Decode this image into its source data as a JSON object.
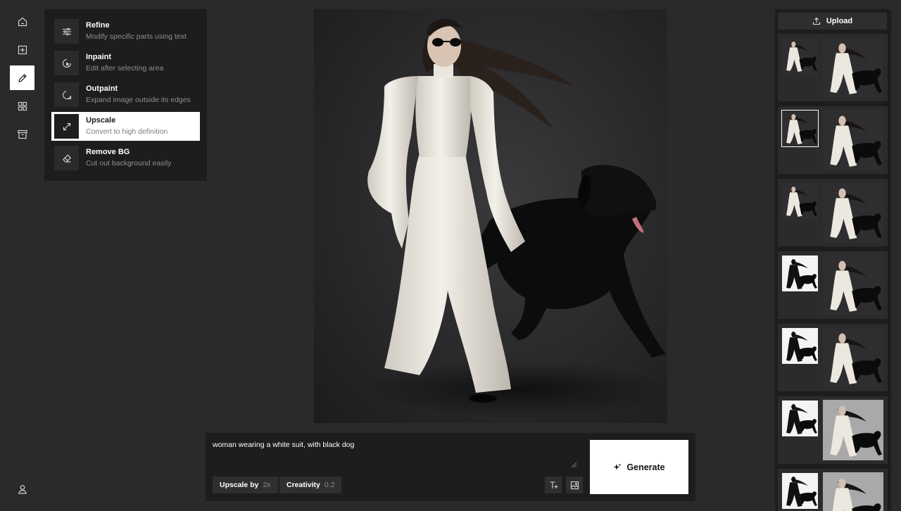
{
  "rail": {
    "items": [
      {
        "name": "home",
        "icon": "home-icon",
        "active": false
      },
      {
        "name": "new",
        "icon": "plus-square-icon",
        "active": false
      },
      {
        "name": "edit",
        "icon": "pencil-icon",
        "active": true
      },
      {
        "name": "gallery",
        "icon": "grid-icon",
        "active": false
      },
      {
        "name": "archive",
        "icon": "archive-icon",
        "active": false
      }
    ],
    "account_icon": "user-icon"
  },
  "tools": [
    {
      "title": "Refine",
      "description": "Modify specific parts using text",
      "icon": "sliders-icon",
      "active": false
    },
    {
      "title": "Inpaint",
      "description": "Edit after selecting area",
      "icon": "inpaint-icon",
      "active": false
    },
    {
      "title": "Outpaint",
      "description": "Expand image outside its edges",
      "icon": "outpaint-icon",
      "active": false
    },
    {
      "title": "Upscale",
      "description": "Convert to high definition",
      "icon": "expand-arrows-icon",
      "active": true
    },
    {
      "title": "Remove BG",
      "description": "Cut out background easily",
      "icon": "eraser-icon",
      "active": false
    }
  ],
  "prompt": {
    "text": "woman wearing a white suit, with black dog",
    "upscale_label": "Upscale by",
    "upscale_value": "2x",
    "creativity_label": "Creativity",
    "creativity_value": "0.2",
    "generate_label": "Generate"
  },
  "history": {
    "upload_label": "Upload",
    "items": [
      {
        "small_bg": "dark",
        "large_bg": "dark",
        "selected": false
      },
      {
        "small_bg": "dark",
        "large_bg": "dark",
        "selected": true
      },
      {
        "small_bg": "dark",
        "large_bg": "dark",
        "selected": false
      },
      {
        "small_bg": "white",
        "large_bg": "dark",
        "selected": false
      },
      {
        "small_bg": "white",
        "large_bg": "dark",
        "selected": false
      },
      {
        "small_bg": "white",
        "large_bg": "gray",
        "selected": false
      },
      {
        "small_bg": "white",
        "large_bg": "gray",
        "selected": false
      }
    ]
  },
  "colors": {
    "background": "#2a2a2a",
    "panel": "#1d1d1d",
    "accent": "#ffffff"
  }
}
